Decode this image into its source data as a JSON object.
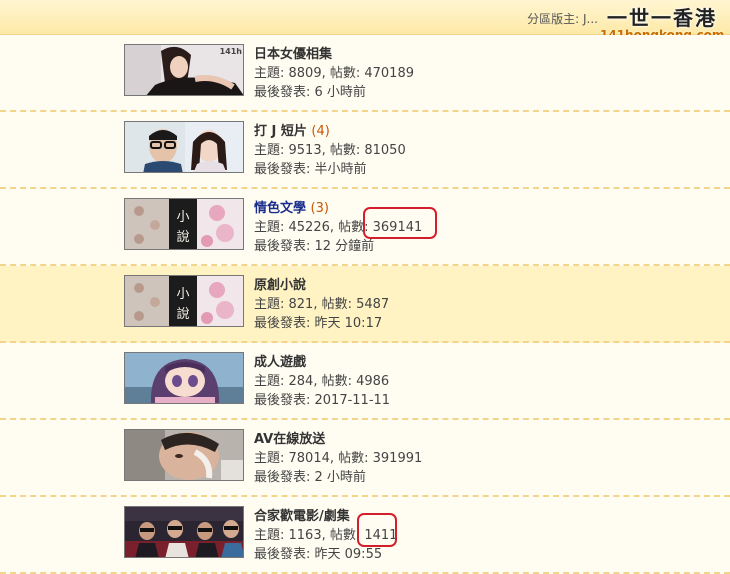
{
  "header": {
    "moderator_label": "分區版主: J...",
    "logo_text": "一世一香港",
    "logo_url": "141hongkong.com"
  },
  "forums": [
    {
      "title": "日本女優相集",
      "new_posts": "",
      "stats_text": "主題: 8809, 帖數: 470189",
      "last_post_text": "最後發表: 6 小時前",
      "thumbnail": "photo-thumbnail",
      "thumb_tag": "141h"
    },
    {
      "title": "打 J 短片",
      "new_posts": "(4)",
      "stats_text": "主題: 9513, 帖數: 81050",
      "last_post_text": "最後發表: 半小時前",
      "thumbnail": "video-thumbnail"
    },
    {
      "title": "情色文學",
      "new_posts": "(3)",
      "stats_text": "主題: 45226, 帖數: 369141",
      "last_post_text": "最後發表: 12 分鐘前",
      "thumbnail": "novel-thumbnail",
      "thumb_tag": "小說"
    },
    {
      "title": "原創小說",
      "new_posts": "",
      "stats_text": "主題: 821, 帖數: 5487",
      "last_post_text": "最後發表: 昨天 10:17",
      "thumbnail": "novel-thumbnail",
      "thumb_tag": "小說"
    },
    {
      "title": "成人遊戲",
      "new_posts": "",
      "stats_text": "主題: 284, 帖數: 4986",
      "last_post_text": "最後發表: 2017-11-11",
      "thumbnail": "game-thumbnail"
    },
    {
      "title": "AV在線放送",
      "new_posts": "",
      "stats_text": "主題: 78014, 帖數: 391991",
      "last_post_text": "最後發表: 2 小時前",
      "thumbnail": "video-thumbnail"
    },
    {
      "title": "合家歡電影/劇集",
      "new_posts": "",
      "stats_text": "主題: 1163, 帖數: 1411",
      "last_post_text": "最後發表: 昨天 09:55",
      "thumbnail": "movie-thumbnail"
    }
  ],
  "colors": {
    "header_bg": "#fde9a6",
    "row_bg": "#fffdf2",
    "row_hover_bg": "#fff3c4",
    "link_blue": "#1a2d8c",
    "new_count": "#cc5500",
    "highlight_circle": "#d31f2c"
  }
}
